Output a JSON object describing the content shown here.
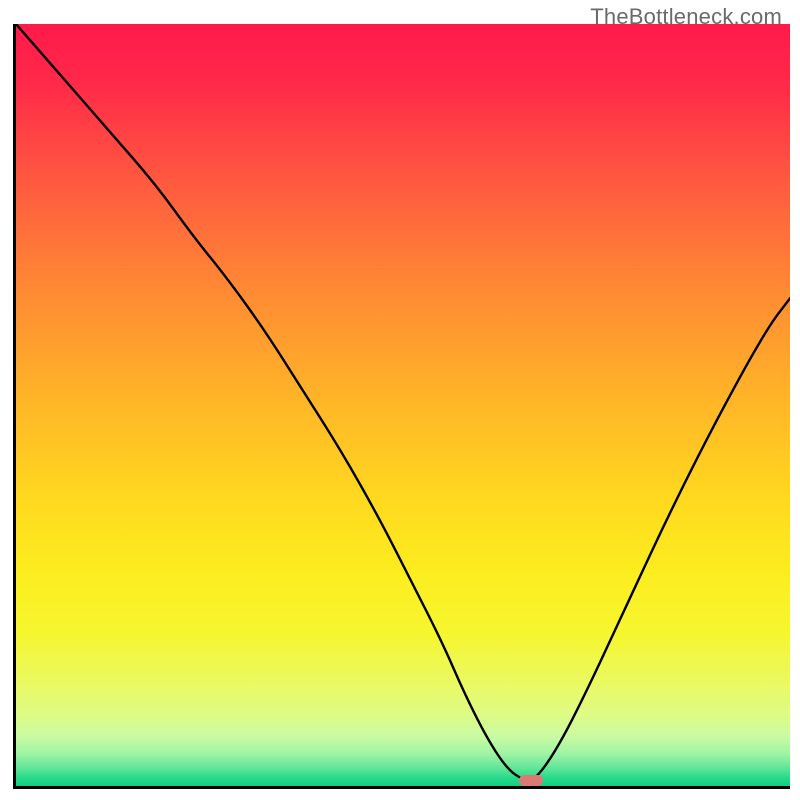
{
  "watermark": "TheBottleneck.com",
  "chart_data": {
    "type": "line",
    "title": "",
    "xlabel": "",
    "ylabel": "",
    "xlim": [
      0,
      100
    ],
    "ylim": [
      0,
      100
    ],
    "grid": false,
    "series": [
      {
        "name": "bottleneck-curve",
        "x": [
          0,
          6,
          12,
          18,
          23,
          27,
          32,
          37,
          42,
          47,
          51,
          55,
          58,
          61,
          63.5,
          65.5,
          67,
          70,
          74,
          79,
          85,
          91,
          97,
          100
        ],
        "y": [
          100,
          93,
          86,
          79,
          72,
          67,
          60,
          52,
          44,
          35,
          27,
          19,
          12,
          6,
          2.2,
          0.8,
          0.7,
          5,
          13,
          24,
          37,
          49,
          60,
          64
        ]
      }
    ],
    "marker": {
      "name": "optimal-point",
      "x": 66.5,
      "y": 0.7,
      "width_pct": 3.1,
      "height_pct": 1.45,
      "color": "#db7a74"
    },
    "background_gradient": {
      "stops": [
        {
          "offset": 0.0,
          "color": "#ff1a4b"
        },
        {
          "offset": 0.08,
          "color": "#ff2a49"
        },
        {
          "offset": 0.2,
          "color": "#ff5740"
        },
        {
          "offset": 0.35,
          "color": "#ff8a34"
        },
        {
          "offset": 0.5,
          "color": "#ffb727"
        },
        {
          "offset": 0.62,
          "color": "#ffd81f"
        },
        {
          "offset": 0.72,
          "color": "#fced1f"
        },
        {
          "offset": 0.8,
          "color": "#f6f62f"
        },
        {
          "offset": 0.86,
          "color": "#ebf95e"
        },
        {
          "offset": 0.905,
          "color": "#dffb84"
        },
        {
          "offset": 0.935,
          "color": "#c9fba2"
        },
        {
          "offset": 0.958,
          "color": "#9ef4a4"
        },
        {
          "offset": 0.975,
          "color": "#66e79a"
        },
        {
          "offset": 0.99,
          "color": "#26d989"
        },
        {
          "offset": 1.0,
          "color": "#0fd081"
        }
      ]
    }
  }
}
